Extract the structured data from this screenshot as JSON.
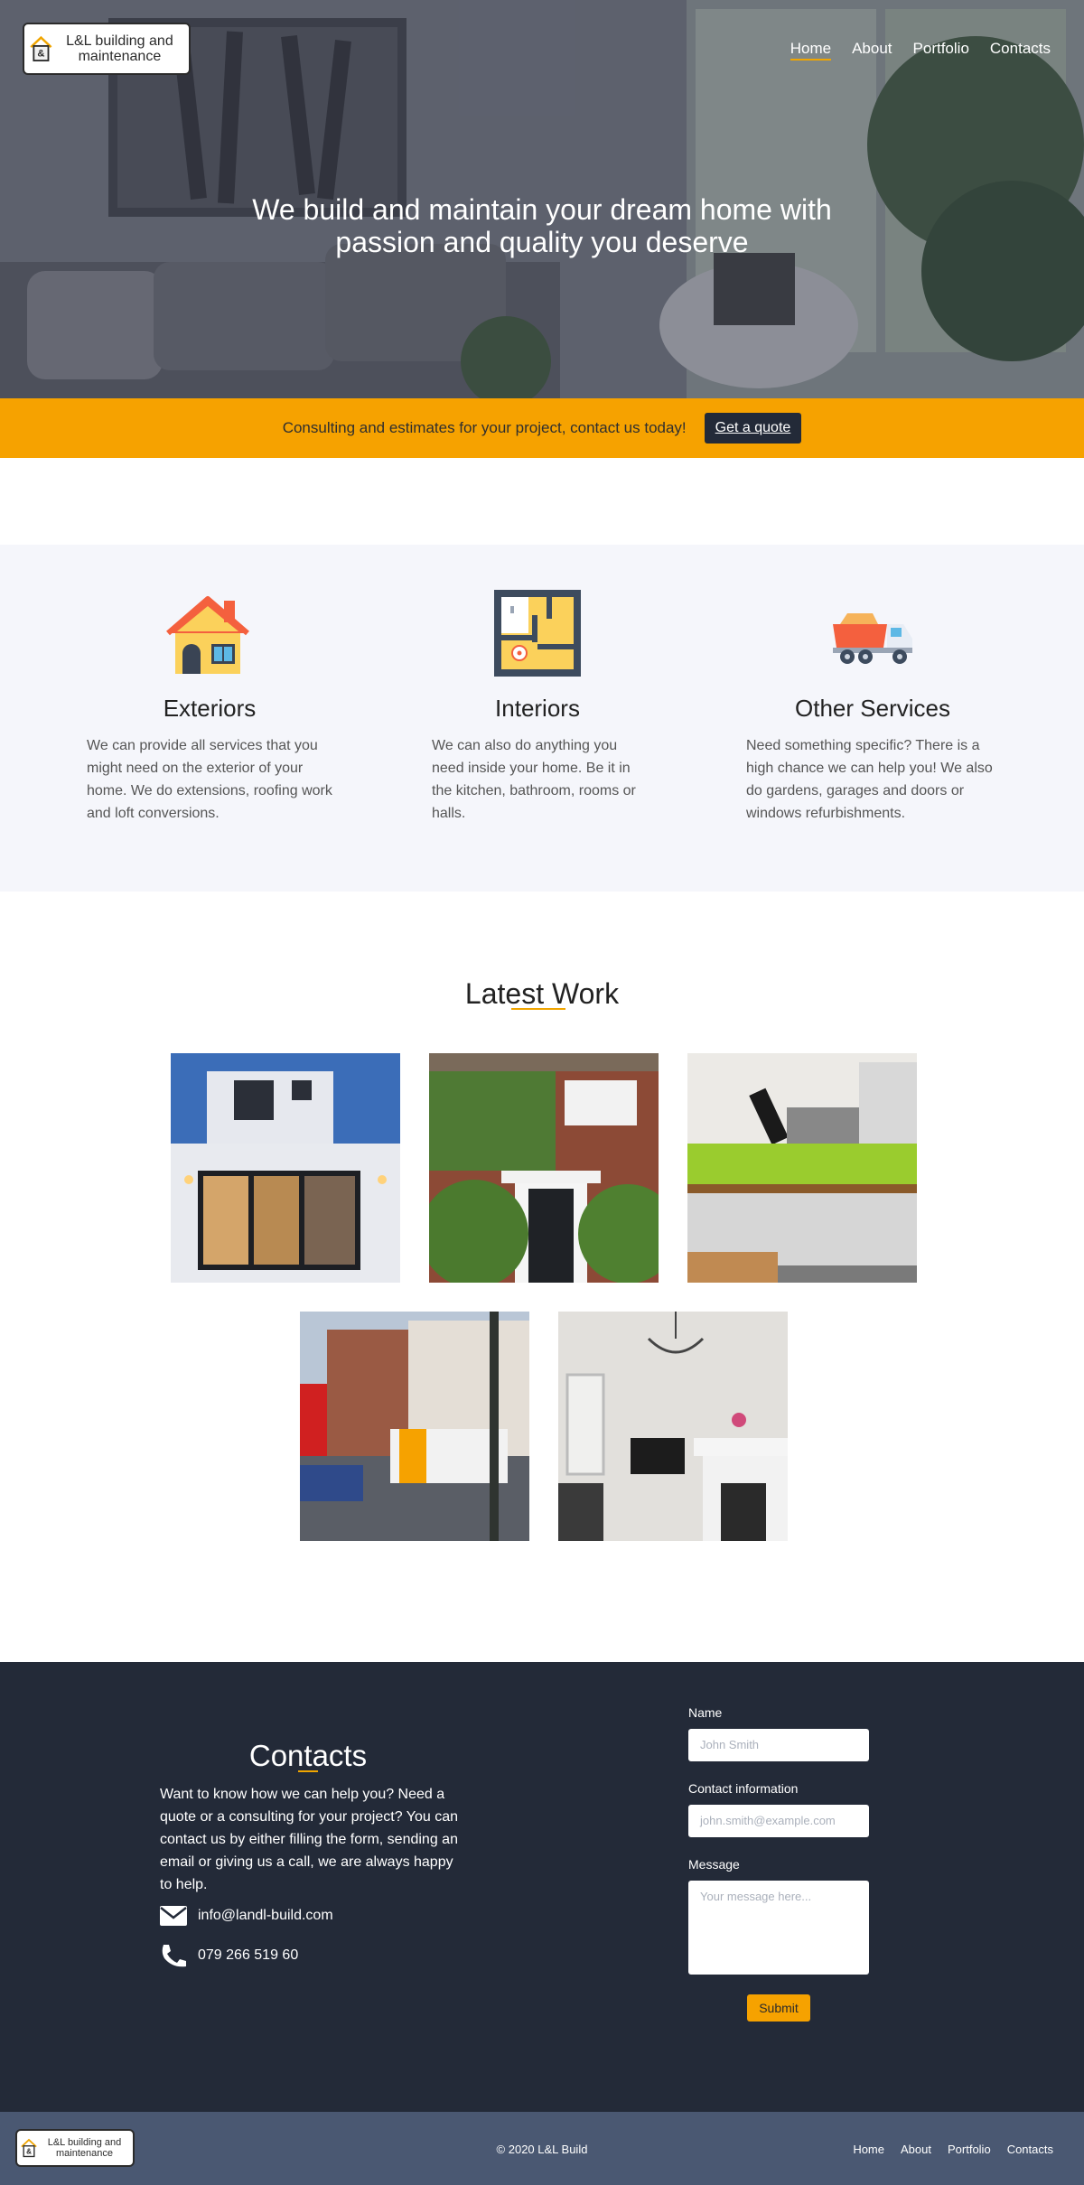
{
  "brand": {
    "logo_text": "L&L building and maintenance",
    "logo_mark": "&"
  },
  "nav": [
    {
      "label": "Home",
      "active": true
    },
    {
      "label": "About"
    },
    {
      "label": "Portfolio"
    },
    {
      "label": "Contacts"
    }
  ],
  "hero": {
    "headline_line1": "We build and maintain your dream home with",
    "headline_line2": "passion and quality you deserve"
  },
  "quote_bar": {
    "text": "Consulting and estimates for your project, contact us today!",
    "button": "Get a quote"
  },
  "services": [
    {
      "icon": "house-icon",
      "title": "Exteriors",
      "text": "We can provide all services that you might need on the exterior of your home. We do extensions, roofing work and loft conversions."
    },
    {
      "icon": "floor-plan-icon",
      "title": "Interiors",
      "text": "We can also do anything you need inside your home. Be it in the kitchen, bathroom, rooms or halls."
    },
    {
      "icon": "dump-truck-icon",
      "title": "Other Services",
      "text": "Need something specific? There is a high chance we can help you! We also do gardens, garages and doors or windows refurbishments."
    }
  ],
  "latest_work": {
    "title": "Latest Work"
  },
  "contacts": {
    "title": "Contacts",
    "text": "Want to know how we can help you? Need a quote or a consulting for your project? You can contact us by either filling the form, sending an email or giving us a call, we are always happy to help.",
    "email": "info@landl-build.com",
    "phone": "079 266 519 60",
    "form": {
      "name_label": "Name",
      "name_placeholder": "John Smith",
      "contact_label": "Contact information",
      "contact_placeholder": "john.smith@example.com",
      "message_label": "Message",
      "message_placeholder": "Your message here...",
      "submit": "Submit"
    }
  },
  "footer": {
    "copyright": "© 2020 L&L Build",
    "nav": [
      "Home",
      "About",
      "Portfolio",
      "Contacts"
    ]
  },
  "colors": {
    "accent": "#f6a200",
    "dark": "#232a38",
    "footer": "#4a5872",
    "services_bg": "#f5f6fb"
  }
}
